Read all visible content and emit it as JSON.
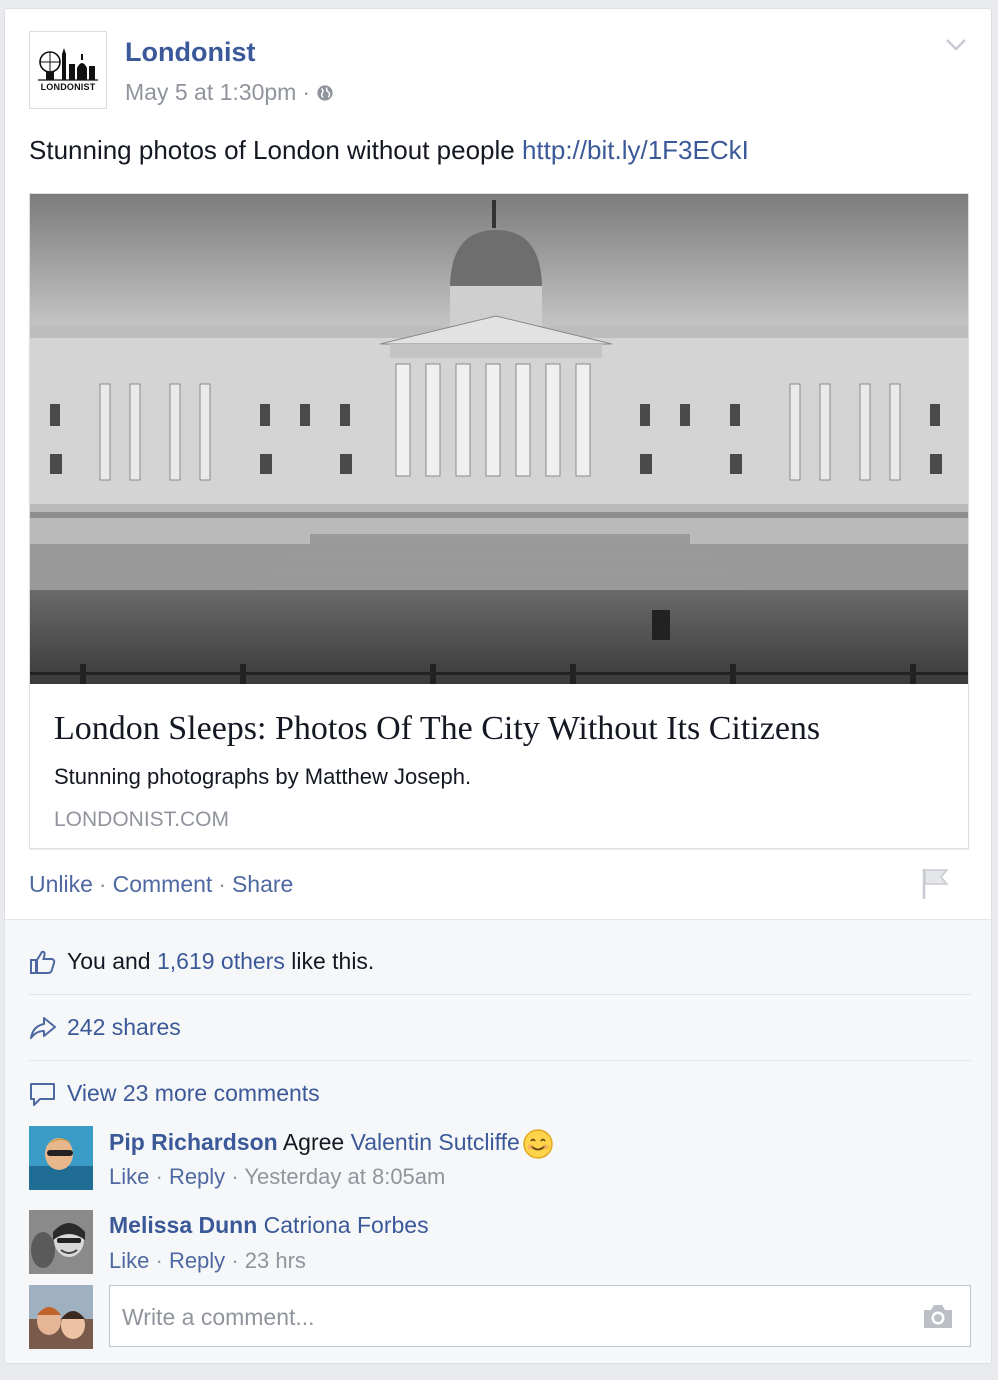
{
  "post": {
    "page_name": "Londonist",
    "logo_text": "LONDONIST",
    "timestamp": "May 5 at 1:30pm",
    "separator": "·",
    "privacy_icon": "globe-icon",
    "menu_icon": "chevron-down-icon",
    "text": "Stunning photos of London without people",
    "link_url": "http://bit.ly/1F3ECkI"
  },
  "link_card": {
    "image_alt": "National Gallery, Trafalgar Square",
    "title": "London Sleeps: Photos Of The City Without Its Citizens",
    "description": "Stunning photographs by Matthew Joseph.",
    "domain": "LONDONIST.COM"
  },
  "actions": {
    "unlike": "Unlike",
    "comment": "Comment",
    "share": "Share",
    "dot": "·",
    "flag_icon": "flag-icon"
  },
  "feedback": {
    "likes_prefix": "You and",
    "likes_link": "1,619 others",
    "likes_suffix": "like this.",
    "shares": "242 shares",
    "view_more": "View 23 more comments"
  },
  "comments": [
    {
      "author": "Pip Richardson",
      "text": "Agree",
      "mention": "Valentin Sutcliffe",
      "like": "Like",
      "reply": "Reply",
      "time": "Yesterday at 8:05am"
    },
    {
      "author": "Melissa Dunn",
      "text": "",
      "mention": "Catriona Forbes",
      "like": "Like",
      "reply": "Reply",
      "time": "23 hrs"
    }
  ],
  "compose": {
    "placeholder": "Write a comment...",
    "camera_icon": "camera-icon"
  },
  "colors": {
    "link_blue": "#3b5998",
    "action_blue": "#4e69a2",
    "meta_gray": "#90949c",
    "background": "#e9eaed"
  }
}
